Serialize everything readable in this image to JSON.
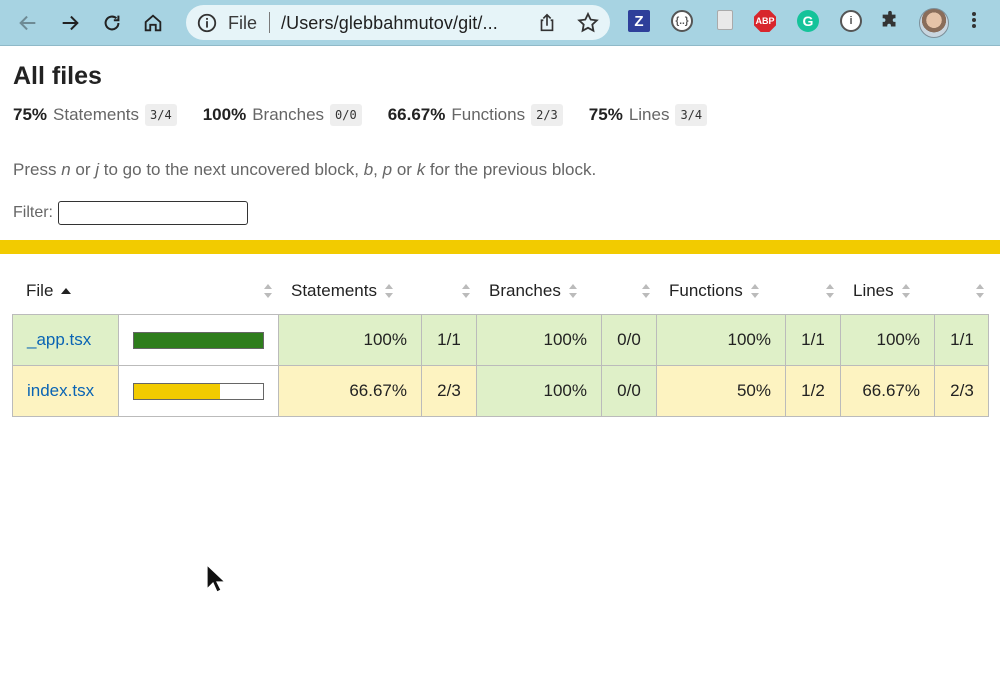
{
  "browser": {
    "omnibox": {
      "scheme_label": "File",
      "url": "/Users/glebbahmutov/git/..."
    },
    "extensions": [
      {
        "name": "z-icon",
        "glyph": "Z"
      },
      {
        "name": "json-viewer-icon",
        "glyph": "{..}"
      },
      {
        "name": "page-icon",
        "glyph": ""
      },
      {
        "name": "adblock-icon",
        "glyph": "ABP"
      },
      {
        "name": "grammarly-icon",
        "glyph": "G"
      },
      {
        "name": "password-manager-icon",
        "glyph": "i"
      }
    ]
  },
  "page": {
    "title": "All files",
    "summary": [
      {
        "pct": "75%",
        "label": "Statements",
        "fraction": "3/4"
      },
      {
        "pct": "100%",
        "label": "Branches",
        "fraction": "0/0"
      },
      {
        "pct": "66.67%",
        "label": "Functions",
        "fraction": "2/3"
      },
      {
        "pct": "75%",
        "label": "Lines",
        "fraction": "3/4"
      }
    ],
    "hint": {
      "press": "Press",
      "k1": "n",
      "or1": "or",
      "k2": "j",
      "next": "to go to the next uncovered block,",
      "k3": "b",
      "comma": ",",
      "k4": "p",
      "or2": "or",
      "k5": "k",
      "prev": "for the previous block."
    },
    "filter_label": "Filter:",
    "filter_value": "",
    "status_color": "#f2cb00"
  },
  "table": {
    "headers": {
      "file": "File",
      "statements": "Statements",
      "branches": "Branches",
      "functions": "Functions",
      "lines": "Lines"
    },
    "rows": [
      {
        "file": "_app.tsx",
        "coverage_level": "high",
        "bar_fill_pct": 100,
        "bar_color": "#2e7d1c",
        "statements": "100%",
        "statements_frac": "1/1",
        "branches": "100%",
        "branches_frac": "0/0",
        "functions": "100%",
        "functions_frac": "1/1",
        "lines": "100%",
        "lines_frac": "1/1"
      },
      {
        "file": "index.tsx",
        "coverage_level": "medium",
        "bar_fill_pct": 66.67,
        "bar_color": "#f2cb00",
        "statements": "66.67%",
        "statements_frac": "2/3",
        "branches": "100%",
        "branches_frac": "0/0",
        "functions": "50%",
        "functions_frac": "1/2",
        "lines": "66.67%",
        "lines_frac": "2/3"
      }
    ]
  }
}
